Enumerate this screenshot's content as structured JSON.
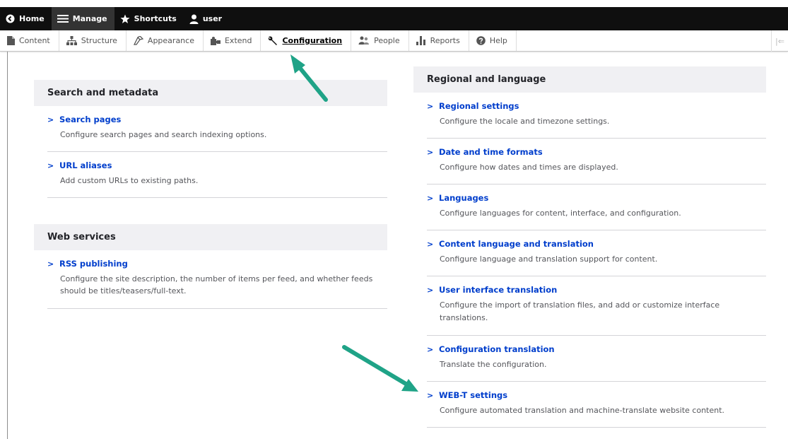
{
  "toolbar": {
    "home_label": "Home",
    "manage_label": "Manage",
    "shortcuts_label": "Shortcuts",
    "user_label": "user"
  },
  "tray": {
    "items": [
      {
        "label": "Content",
        "icon": "content-icon"
      },
      {
        "label": "Structure",
        "icon": "structure-icon"
      },
      {
        "label": "Appearance",
        "icon": "appearance-icon"
      },
      {
        "label": "Extend",
        "icon": "extend-icon"
      },
      {
        "label": "Configuration",
        "icon": "wrench-icon"
      },
      {
        "label": "People",
        "icon": "people-icon"
      },
      {
        "label": "Reports",
        "icon": "reports-icon"
      },
      {
        "label": "Help",
        "icon": "help-icon"
      }
    ],
    "active": "Configuration"
  },
  "left": {
    "search_metadata": {
      "title": "Search and metadata",
      "items": [
        {
          "title": "Search pages",
          "desc": "Configure search pages and search indexing options."
        },
        {
          "title": "URL aliases",
          "desc": "Add custom URLs to existing paths."
        }
      ]
    },
    "web_services": {
      "title": "Web services",
      "items": [
        {
          "title": "RSS publishing",
          "desc1": "Configure the site description, the number of items per feed, and whether feeds",
          "desc2": "should be titles/teasers/full-text."
        }
      ]
    }
  },
  "right": {
    "regional": {
      "title": "Regional and language",
      "items": [
        {
          "title": "Regional settings",
          "desc": "Configure the locale and timezone settings."
        },
        {
          "title": "Date and time formats",
          "desc": "Configure how dates and times are displayed."
        },
        {
          "title": "Languages",
          "desc": "Configure languages for content, interface, and configuration."
        },
        {
          "title": "Content language and translation",
          "desc": "Configure language and translation support for content."
        },
        {
          "title": "User interface translation",
          "desc1": "Configure the import of translation files, and add or customize interface",
          "desc2": "translations."
        },
        {
          "title": "Configuration translation",
          "desc": "Translate the configuration."
        },
        {
          "title": "WEB-T settings",
          "desc": "Configure automated translation and machine-translate website content."
        }
      ]
    }
  },
  "colors": {
    "link": "#003ecc",
    "arrow": "#1fa387",
    "toolbar_bg": "#0f0f0f",
    "panel_header_bg": "#f0f0f3"
  }
}
